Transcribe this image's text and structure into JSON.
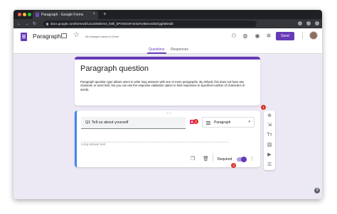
{
  "browser": {
    "tab_title": "Paragraph - Google Forms",
    "tab_close": "×",
    "new_tab": "+",
    "url": "docs.google.com/forms/d/1Zu2D0dOm4_l5l0l_bPOW2sR-bn5zNvIBsIxs4bDQghIB/edit",
    "traffic_colors": [
      "#ff5f57",
      "#febc2e",
      "#28c840"
    ]
  },
  "app": {
    "title": "Paragraph",
    "saved_status": "All changes saved in Drive",
    "send_label": "Send",
    "accent": "#673ab7"
  },
  "form_tabs": [
    {
      "label": "Questions",
      "active": true
    },
    {
      "label": "Responses",
      "active": false
    }
  ],
  "header_card": {
    "title": "Paragraph question",
    "description": "Paragraph question type allows users to write long answers with one or more paragraphs. By default, this does not have any character or word limit, but you can use the response validation option to limit responses to specified number of characters or words."
  },
  "question": {
    "title": "Q1 Tell us about yourself",
    "type": "Paragraph",
    "answer_placeholder": "Long answer text",
    "required_label": "Required",
    "required_on": true
  },
  "callouts": [
    "1",
    "2",
    "3"
  ],
  "icons": {
    "browser_nav": [
      "back-arrow-icon",
      "forward-arrow-icon",
      "reload-icon"
    ],
    "appbar": [
      "customize-theme-icon",
      "palette-icon",
      "preview-eye-icon",
      "settings-gear-icon"
    ],
    "question_footer": [
      "duplicate-icon",
      "delete-trash-icon",
      "more-vert-icon"
    ],
    "floating_toolbar": [
      "add-question-icon",
      "import-questions-icon",
      "add-title-icon",
      "add-image-icon",
      "add-video-icon",
      "add-section-icon"
    ],
    "help": "help-icon"
  }
}
